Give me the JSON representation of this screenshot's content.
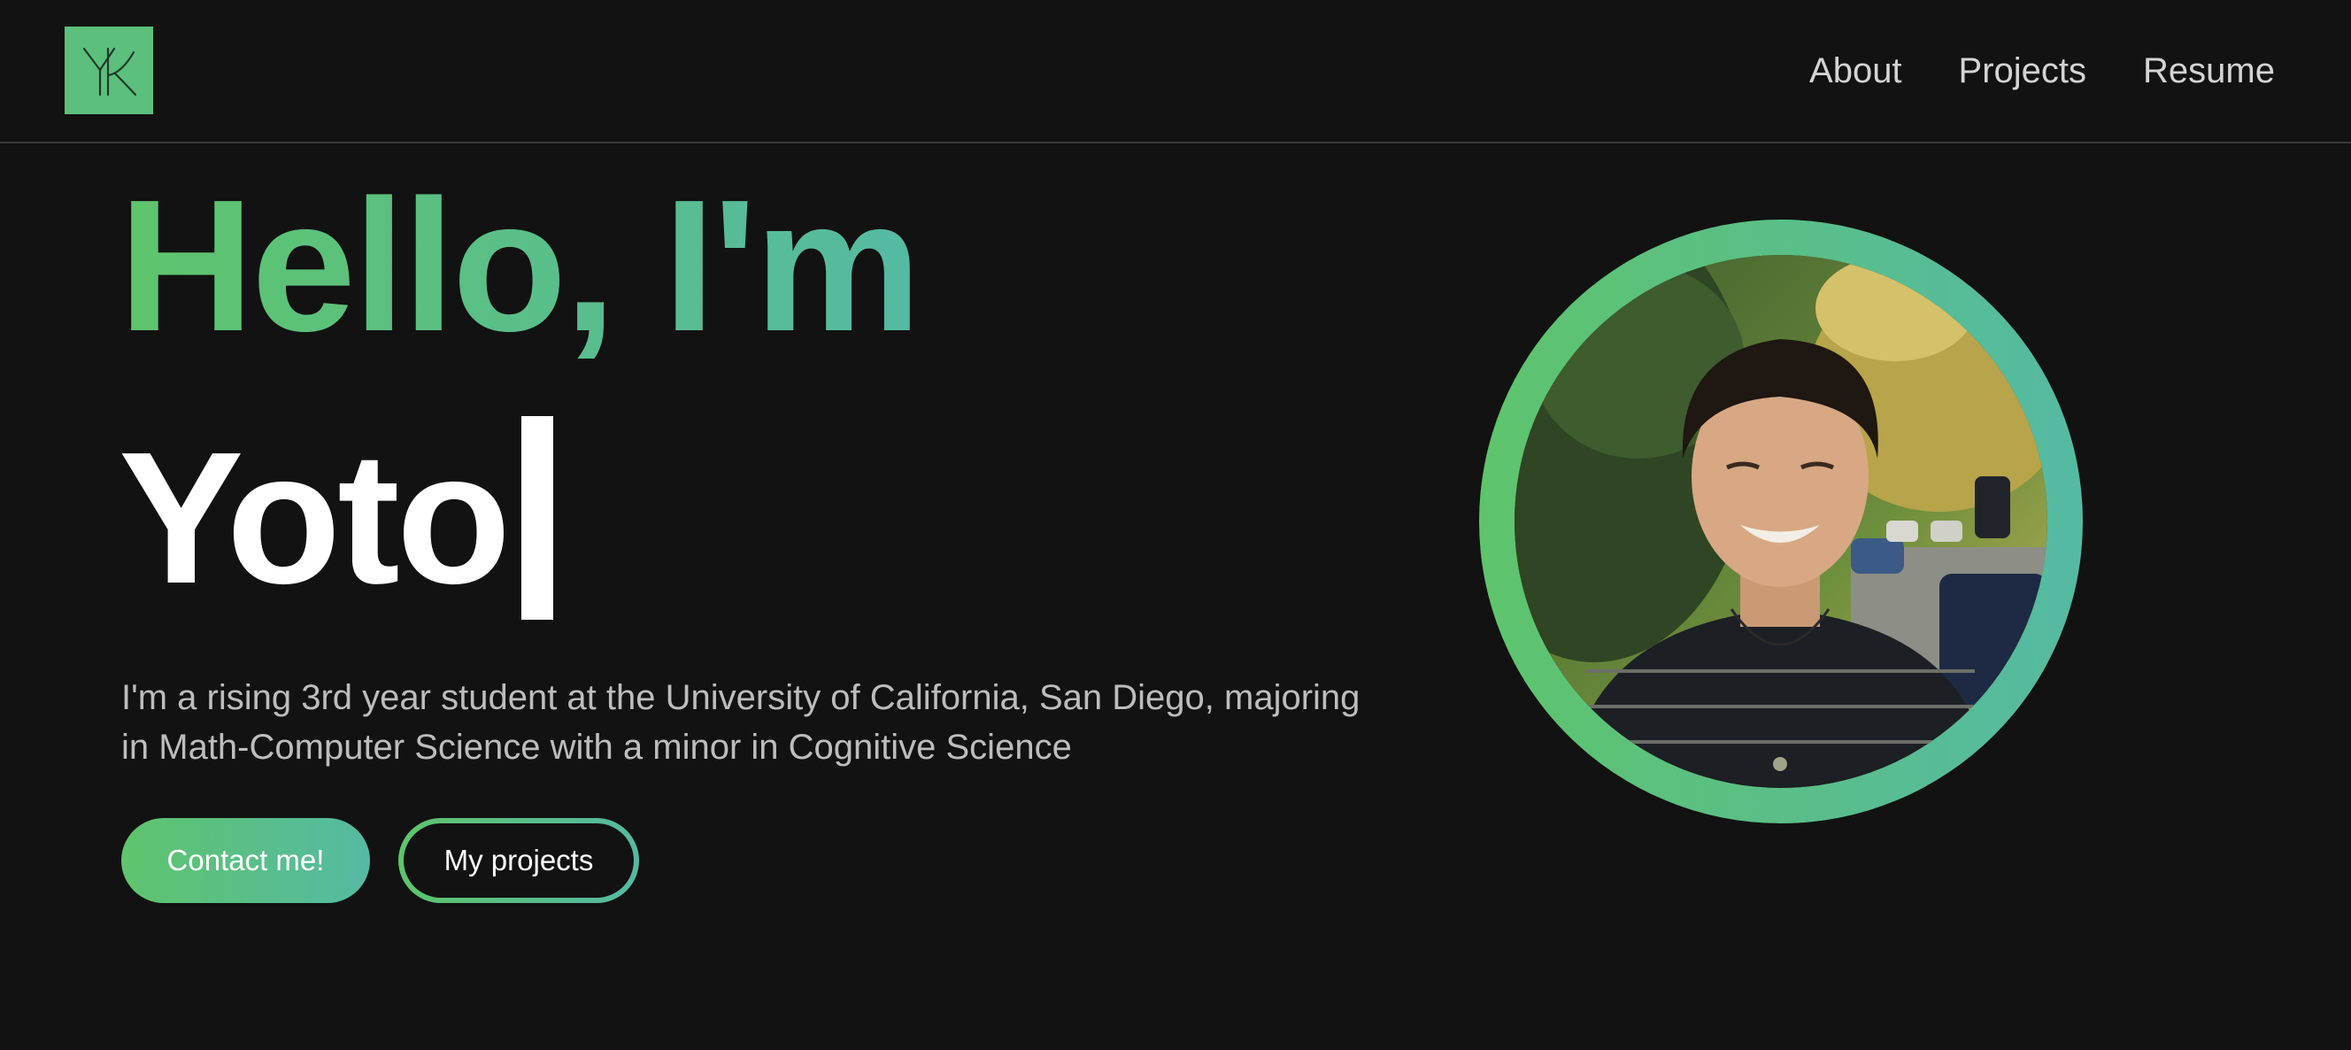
{
  "brand": {
    "logo_initials": "YK",
    "accent_start": "#5ec46c",
    "accent_end": "#55baa3",
    "logo_bg": "#5cbf7c",
    "background": "#121212"
  },
  "nav": {
    "items": [
      {
        "label": "About"
      },
      {
        "label": "Projects"
      },
      {
        "label": "Resume"
      }
    ]
  },
  "hero": {
    "greeting": "Hello, I'm",
    "name_typed": "Yoto",
    "bio": "I'm a rising 3rd year student at the University of California, San Diego, majoring in Math-Computer Science with a minor in Cognitive Science",
    "contact_button": "Contact me!",
    "projects_button": "My projects"
  },
  "profile_photo": {
    "icon": "profile-photo"
  }
}
